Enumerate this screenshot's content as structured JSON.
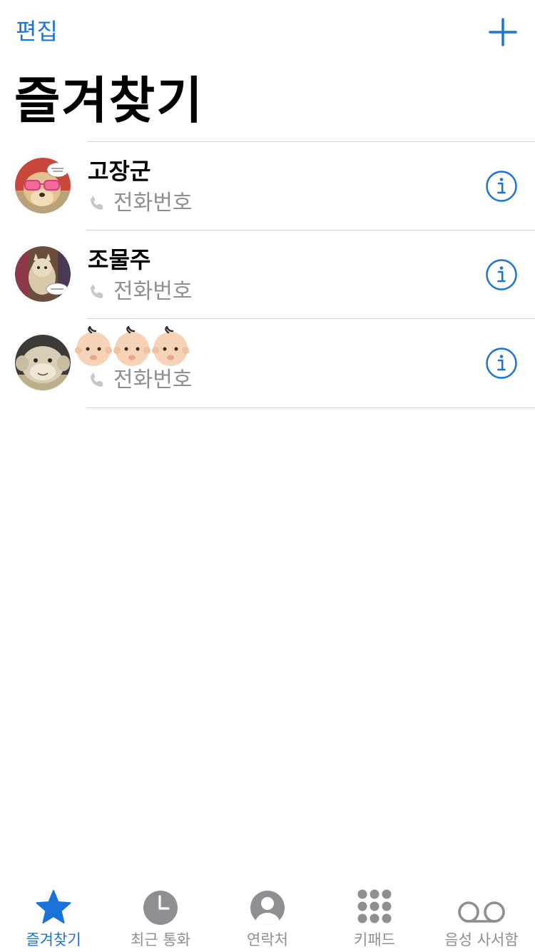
{
  "header": {
    "edit_label": "편집",
    "title": "즐겨찾기"
  },
  "favorites": [
    {
      "name": "고장군",
      "subtitle": "전화번호",
      "avatar": "avatar-dog-sunglasses"
    },
    {
      "name": "조물주",
      "subtitle": "전화번호",
      "avatar": "avatar-cat"
    },
    {
      "name": "👶🏻👶🏻👶🏻",
      "subtitle": "전화번호",
      "avatar": "avatar-plush-monkey"
    }
  ],
  "tabbar": {
    "tabs": [
      {
        "label": "즐겨찾기",
        "icon": "star-icon",
        "active": true
      },
      {
        "label": "최근 통화",
        "icon": "clock-icon",
        "active": false
      },
      {
        "label": "연락처",
        "icon": "person-circle-icon",
        "active": false
      },
      {
        "label": "키패드",
        "icon": "keypad-icon",
        "active": false
      },
      {
        "label": "음성 사서함",
        "icon": "voicemail-icon",
        "active": false
      }
    ]
  },
  "colors": {
    "accent": "#1a73d9",
    "inactive": "#8e8e93",
    "divider": "#cfcfd3"
  }
}
